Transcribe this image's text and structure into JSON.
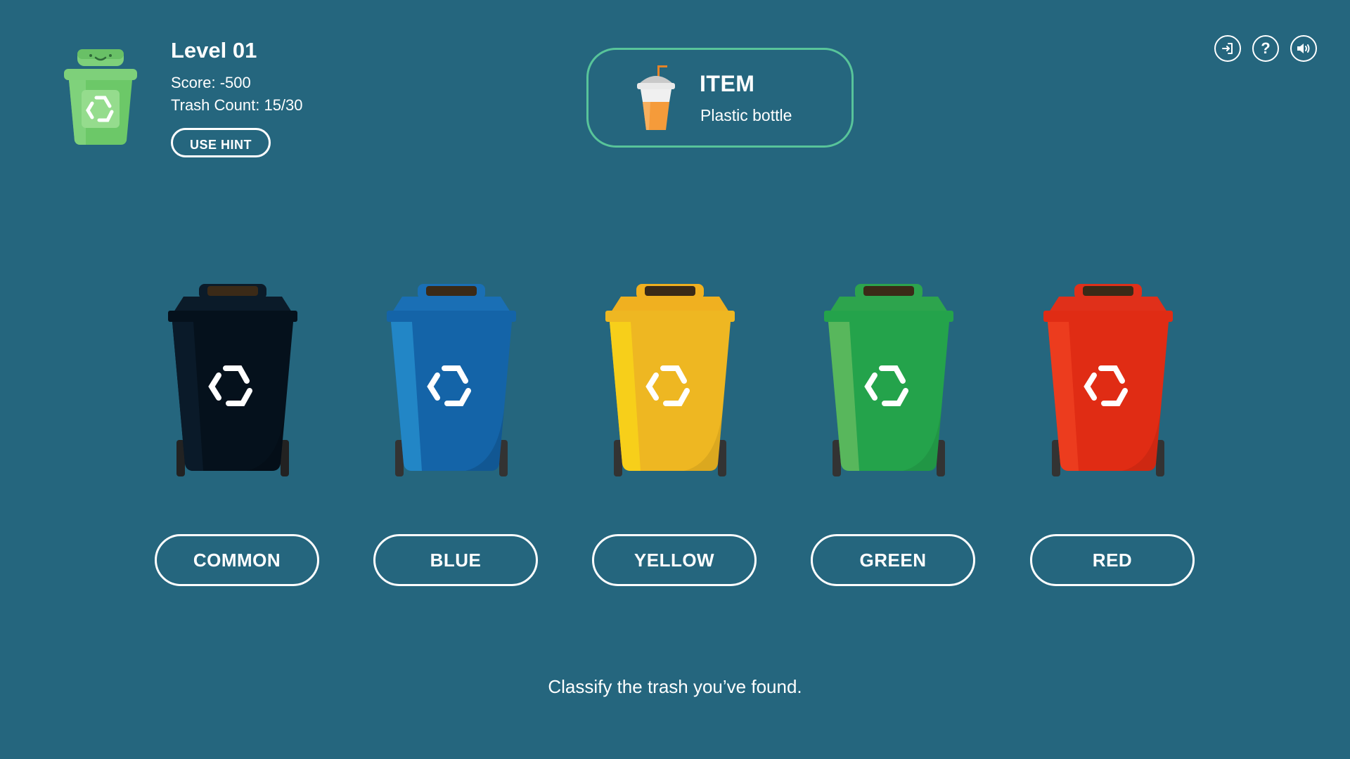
{
  "player": {
    "level": "Level 01",
    "score": "Score: -500",
    "trash_count": "Trash Count: 15/30",
    "hint_label": "USE HINT",
    "mascot_icon": "recycle-bin-mascot-icon"
  },
  "item": {
    "label": "ITEM",
    "name": "Plastic bottle",
    "icon": "plastic-cup-icon"
  },
  "controls": [
    {
      "icon": "exit-icon"
    },
    {
      "icon": "help-icon",
      "glyph": "?"
    },
    {
      "icon": "sound-icon"
    }
  ],
  "bins": [
    {
      "label": "COMMON",
      "color": "#05111c",
      "shade": "#0a1a29",
      "lid": "#0b1b29",
      "icon": "recycle-icon"
    },
    {
      "label": "BLUE",
      "color": "#1464a8",
      "shade": "#2286c6",
      "lid": "#1a6fb5",
      "icon": "recycle-icon"
    },
    {
      "label": "YELLOW",
      "color": "#eeb722",
      "shade": "#f7cf1a",
      "lid": "#f0b020",
      "icon": "recycle-icon"
    },
    {
      "label": "GREEN",
      "color": "#24a34b",
      "shade": "#58b75c",
      "lid": "#2da44d",
      "icon": "recycle-icon"
    },
    {
      "label": "RED",
      "color": "#e02c14",
      "shade": "#ec3c1e",
      "lid": "#e0301a",
      "icon": "recycle-icon"
    }
  ],
  "instruction": "Classify the trash you’ve found."
}
